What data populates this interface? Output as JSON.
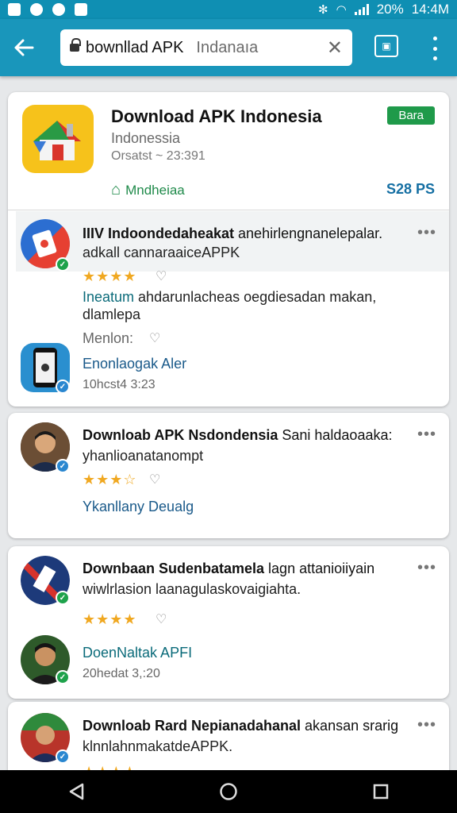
{
  "status_bar": {
    "battery": "20%",
    "time": "14:4M"
  },
  "toolbar": {
    "search_query": "bownllad APK",
    "search_hint": "Indanaıa",
    "clear_glyph": "✕",
    "back_icon": "arrow-left-icon",
    "tabs_icon": "tab-switcher-icon",
    "menu_icon": "more-vert-icon"
  },
  "app": {
    "title": "Download APK Indonesia",
    "subtitle": "Indonessia",
    "meta": "Orsatst ~ 23:391",
    "badge": "Bara",
    "developer": "Mndheiaa",
    "price": "S28 PS",
    "accent": "#1f9a4a"
  },
  "reviews": [
    {
      "title_bold": "IIIV Indoondedaheakat",
      "title_rest": " anehirlengnanelepalar.",
      "line2": "adkall cannaraaiceAPPK",
      "stars": 4,
      "teal": "Ineatum",
      "teal_rest": " ahdarunlacheas oegdiesadan makan,",
      "line_extra": "dlamlepa",
      "mention": "Menlon:",
      "name": "Enonlaogak Aler",
      "time": "10hcst4 3:23"
    },
    {
      "title_bold": "Downloab APK Nsdondensia",
      "title_rest": " Sani haldaoaaka:",
      "line2": "yhanlioanatanompt",
      "stars": 3.5,
      "name": "Ykanllany Deualg"
    },
    {
      "title_bold": "Downbaan Sudenbatamela",
      "title_rest": " lagn attanioiiyain",
      "line2": "wiwlrlasion laanagulaskovaigiahta.",
      "stars": 4,
      "name": "DoenNaltak APFI",
      "time": "20hedat 3,:20"
    },
    {
      "title_bold": "Downloab Rard Nepianadahanal",
      "title_rest": " akansan srarig",
      "line2": "klnnlahnmakatdeAPPK."
    }
  ],
  "nav": {
    "back": "nav-back-icon",
    "home": "nav-home-icon",
    "recents": "nav-recents-icon"
  }
}
